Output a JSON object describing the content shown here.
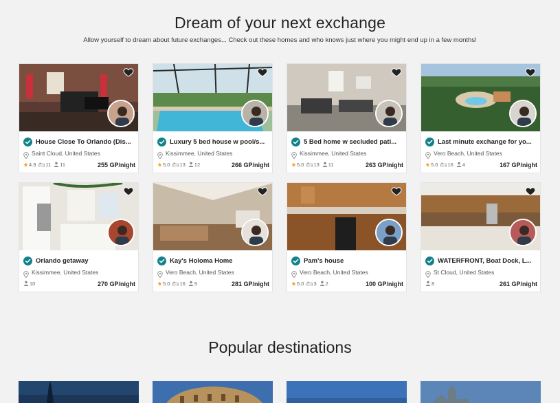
{
  "section": {
    "title": "Dream of your next exchange",
    "subtitle": "Allow yourself to dream about future exchanges... Check out these homes and who knows just where you might end up in a few months!"
  },
  "colors": {
    "accent": "#13818a",
    "star": "#f5a623",
    "heart": "#ffffff"
  },
  "homes": [
    {
      "name": "House Close To Orlando (Dis...",
      "location": "Saint Cloud, United States",
      "rating": "4.9",
      "beds": "11",
      "guests": "11",
      "price": "255 GP/night",
      "photo": "living-room",
      "bg": "#6b4a3c"
    },
    {
      "name": "Luxury 5 bed house w pool/s...",
      "location": "Kissimmee, United States",
      "rating": "5.0",
      "beds": "13",
      "guests": "12",
      "price": "266 GP/night",
      "photo": "pool",
      "bg": "#7a8a7a"
    },
    {
      "name": "5 Bed home w secluded pati...",
      "location": "Kissimmee, United States",
      "rating": "5.0",
      "beds": "13",
      "guests": "11",
      "price": "263 GP/night",
      "photo": "living-room-gray",
      "bg": "#9a938a"
    },
    {
      "name": "Last minute exchange for yo...",
      "location": "Vero Beach, United States",
      "rating": "5.0",
      "beds": "16",
      "guests": "4",
      "price": "167 GP/night",
      "photo": "aerial-resort",
      "bg": "#3d6e3a"
    },
    {
      "name": "Orlando getaway",
      "location": "Kissimmee, United States",
      "rating": "",
      "beds": "",
      "guests": "10",
      "price": "270 GP/night",
      "photo": "white-kitchen",
      "bg": "#d9d6cf"
    },
    {
      "name": "Kay's Holoma Home",
      "location": "Vero Beach, United States",
      "rating": "5.0",
      "beds": "16",
      "guests": "9",
      "price": "281 GP/night",
      "photo": "open-living",
      "bg": "#a88f74"
    },
    {
      "name": "Pam's house",
      "location": "Vero Beach, United States",
      "rating": "5.0",
      "beds": "3",
      "guests": "2",
      "price": "100 GP/night",
      "photo": "wood-kitchen",
      "bg": "#8a5a30"
    },
    {
      "name": "WATERFRONT, Boat Dock, L...",
      "location": "St Cloud, United States",
      "rating": "",
      "beds": "",
      "guests": "8",
      "price": "261 GP/night",
      "photo": "kitchen-tile",
      "bg": "#b48a5a"
    }
  ],
  "popular": {
    "title": "Popular destinations",
    "destinations": [
      {
        "photo": "paris-sky"
      },
      {
        "photo": "rome-sky"
      },
      {
        "photo": "blue-sky"
      },
      {
        "photo": "quebec-sky"
      }
    ]
  }
}
